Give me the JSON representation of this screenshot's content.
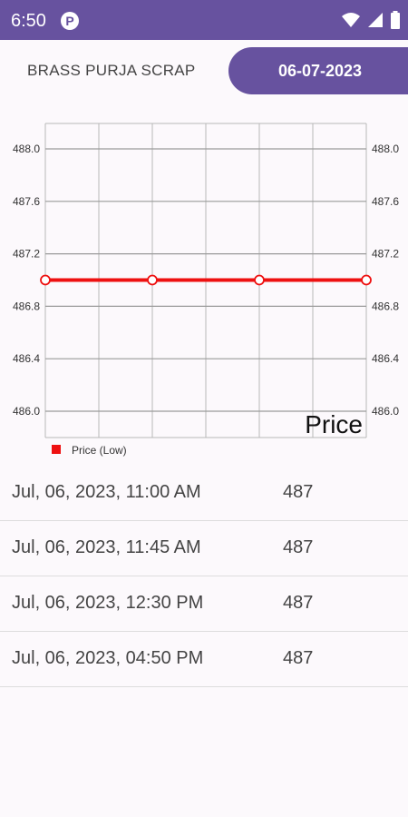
{
  "status_bar": {
    "time": "6:50",
    "app_icon_letter": "P",
    "icons": [
      "wifi-icon",
      "signal-icon",
      "battery-icon"
    ]
  },
  "header": {
    "product_name": "BRASS PURJA SCRAP",
    "date": "06-07-2023"
  },
  "chart_data": {
    "type": "line",
    "x": [
      "Jul, 06, 2023, 11:00 AM",
      "Jul, 06, 2023, 11:45 AM",
      "Jul, 06, 2023, 12:30 PM",
      "Jul, 06, 2023, 04:50 PM"
    ],
    "series": [
      {
        "name": "Price (Low)",
        "values": [
          487,
          487,
          487,
          487
        ],
        "color": "#ee1111"
      }
    ],
    "ylim": [
      486.0,
      488.0
    ],
    "y_ticks": [
      "486.0",
      "486.4",
      "486.8",
      "487.2",
      "487.6",
      "488.0"
    ],
    "dual_y_axis": true,
    "grid": true,
    "legend": "bottom-left",
    "description": "Price"
  },
  "rows": [
    {
      "date": "Jul, 06, 2023, 11:00 AM",
      "price": "487"
    },
    {
      "date": "Jul, 06, 2023, 11:45 AM",
      "price": "487"
    },
    {
      "date": "Jul, 06, 2023, 12:30 PM",
      "price": "487"
    },
    {
      "date": "Jul, 06, 2023, 04:50 PM",
      "price": "487"
    }
  ]
}
